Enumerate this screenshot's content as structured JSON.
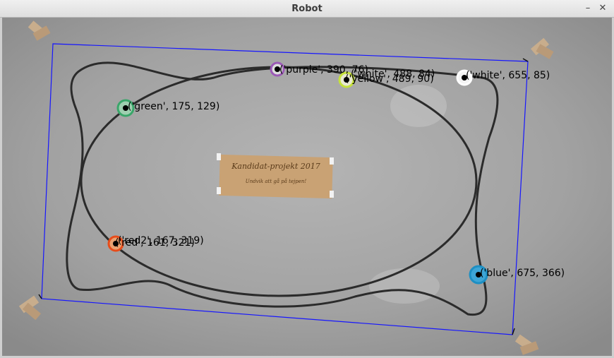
{
  "window": {
    "title": "Robot",
    "minimize_glyph": "–",
    "close_glyph": "✕"
  },
  "sign": {
    "title": "Kandidat-projekt 2017",
    "subtitle": "Undvik att gå på tejpen!"
  },
  "labels": [
    {
      "key": "purple",
      "text": "('purple', 390, 76)",
      "color": "#9b59b6"
    },
    {
      "key": "yellow",
      "text": "('yellow', 489, 90)",
      "color": "#c6e23a"
    },
    {
      "key": "white2",
      "text": "('white', 488, 84)",
      "color": "#ffffff"
    },
    {
      "key": "white",
      "text": "('white', 655, 85)",
      "color": "#ffffff"
    },
    {
      "key": "green",
      "text": "('green', 175, 129)",
      "color": "#3aa66a"
    },
    {
      "key": "red2",
      "text": "('red2', 167, 319)",
      "color": "#e74c1a"
    },
    {
      "key": "red",
      "text": "('red', 161, 321)",
      "color": "#e74c1a"
    },
    {
      "key": "blue",
      "text": "('blue', 675, 366)",
      "color": "#1d8fc3"
    }
  ],
  "colors": {
    "boundary": "#1616ff",
    "track": "#2b2b2b",
    "floor": "#9c9c9c",
    "marker_center": "#000000"
  }
}
